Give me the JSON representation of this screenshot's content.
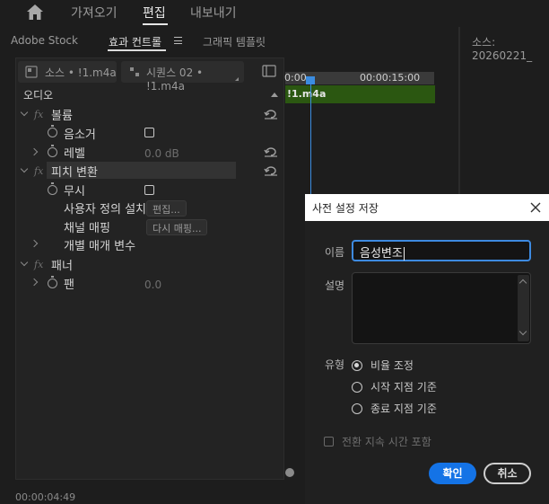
{
  "topnav": {
    "import": "가져오기",
    "edit": "편집",
    "export": "내보내기"
  },
  "panel_tabs": {
    "adobe_stock": "Adobe Stock",
    "effect_controls": "효과 컨트롤",
    "graphics_templates": "그래픽 템플릿"
  },
  "source_monitor_title": "소스: 20260221_",
  "source_pill": "소스 • !1.m4a",
  "sequence_pill": "시퀀스 02 • !1.m4a",
  "timeline": {
    "start": "0:00",
    "mid": "00:00:15:00",
    "clip_name": "!1.m4a"
  },
  "effects": {
    "audio_header": "오디오",
    "volume": "볼륨",
    "bypass": "음소거",
    "level": "레벨",
    "level_value": "0.0 dB",
    "pitch_shift": "피치 변환",
    "ignore": "무시",
    "custom_setup": "사용자 정의 설치",
    "edit_button": "편집...",
    "channel_mapping": "채널 매핑",
    "remap_button": "다시 매핑...",
    "individual_params": "개별 매개 변수",
    "panner": "패너",
    "pan": "팬",
    "pan_value": "0.0"
  },
  "timecode": "00:00:04:49",
  "dialog": {
    "title": "사전 설정 저장",
    "name_label": "이름",
    "name_value": "음성변조",
    "description_label": "설명",
    "type_label": "유형",
    "options": [
      "비율 조정",
      "시작 지점 기준",
      "종료 지점 기준"
    ],
    "selected_option": 0,
    "duration_checkbox": "전환 지속 시간 포함",
    "ok": "확인",
    "cancel": "취소"
  }
}
